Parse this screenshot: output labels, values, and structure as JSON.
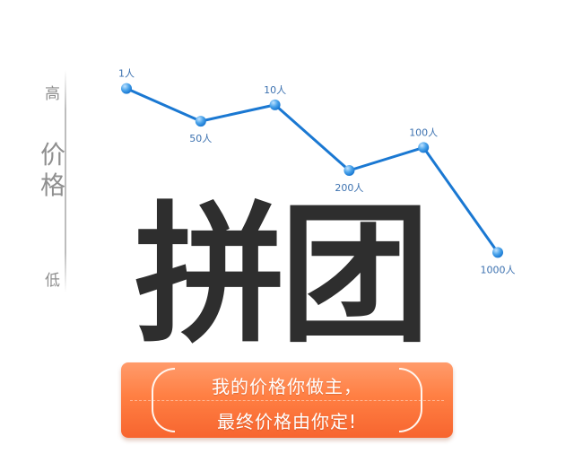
{
  "axis": {
    "high_label": "高",
    "low_label": "低",
    "title_chars": [
      "价",
      "格"
    ]
  },
  "chart_data": {
    "type": "line",
    "categories": [
      "1人",
      "50人",
      "10人",
      "200人",
      "100人",
      "1000人"
    ],
    "values": [
      6,
      5,
      5.5,
      3.5,
      4.2,
      1
    ],
    "ylim": [
      0,
      7
    ],
    "grid": false,
    "colors": {
      "line": "#1a78d2",
      "point": "#4aa3ea",
      "label": "#3d72b0"
    }
  },
  "title": {
    "text": "拼团",
    "color": "#2e2e2e"
  },
  "banner": {
    "line1": "我的价格你做主，",
    "line2": "最终价格由你定!",
    "color_top": "#ff9b6b",
    "color_bottom": "#f7652f"
  }
}
